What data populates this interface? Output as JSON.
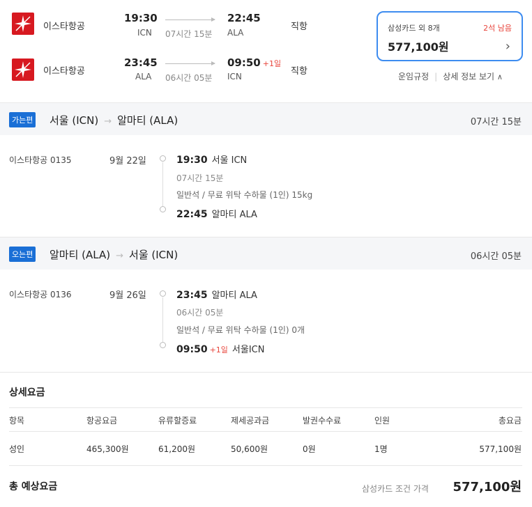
{
  "summary": {
    "outbound": {
      "airline": "이스타항공",
      "dep_time": "19:30",
      "dep_airport": "ICN",
      "duration": "07시간 15분",
      "arr_time": "22:45",
      "arr_airport": "ALA",
      "type": "직항"
    },
    "inbound": {
      "airline": "이스타항공",
      "dep_time": "23:45",
      "dep_airport": "ALA",
      "duration": "06시간 05분",
      "arr_time": "09:50",
      "arr_plus": "+1일",
      "arr_airport": "ICN",
      "type": "직항"
    },
    "price_box": {
      "card": "삼성카드 외 8개",
      "seats_left": "2석 남음",
      "price": "577,100원"
    },
    "links": {
      "fare_rules": "운임규정",
      "details": "상세 정보 보기"
    }
  },
  "outbound_section": {
    "badge": "가는편",
    "from": "서울 (ICN)",
    "to": "알마티 (ALA)",
    "duration": "07시간 15분",
    "flight_no": "이스타항공 0135",
    "date": "9월 22일",
    "dep_time": "19:30",
    "dep_place": "서울 ICN",
    "flight_duration": "07시간 15분",
    "baggage": "일반석 / 무료 위탁 수하물 (1인) 15kg",
    "arr_time": "22:45",
    "arr_place": "알마티 ALA"
  },
  "inbound_section": {
    "badge": "오는편",
    "from": "알마티 (ALA)",
    "to": "서울 (ICN)",
    "duration": "06시간 05분",
    "flight_no": "이스타항공 0136",
    "date": "9월 26일",
    "dep_time": "23:45",
    "dep_place": "알마티 ALA",
    "flight_duration": "06시간 05분",
    "baggage": "일반석 / 무료 위탁 수하물 (1인) 0개",
    "arr_time": "09:50",
    "arr_plus": "+1일",
    "arr_place": "서울ICN"
  },
  "fare": {
    "title": "상세요금",
    "headers": [
      "항목",
      "항공요금",
      "유류할증료",
      "제세공과금",
      "발권수수료",
      "인원",
      "총요금"
    ],
    "row": [
      "성인",
      "465,300원",
      "61,200원",
      "50,600원",
      "0원",
      "1명",
      "577,100원"
    ],
    "total_label": "총 예상요금",
    "total_condition": "삼성카드 조건 가격",
    "total_price": "577,100원"
  },
  "colors": {
    "accent": "#1a6fd6",
    "price_border": "#3d8cf0",
    "warning": "#e8453c",
    "brand_red": "#d71920"
  }
}
